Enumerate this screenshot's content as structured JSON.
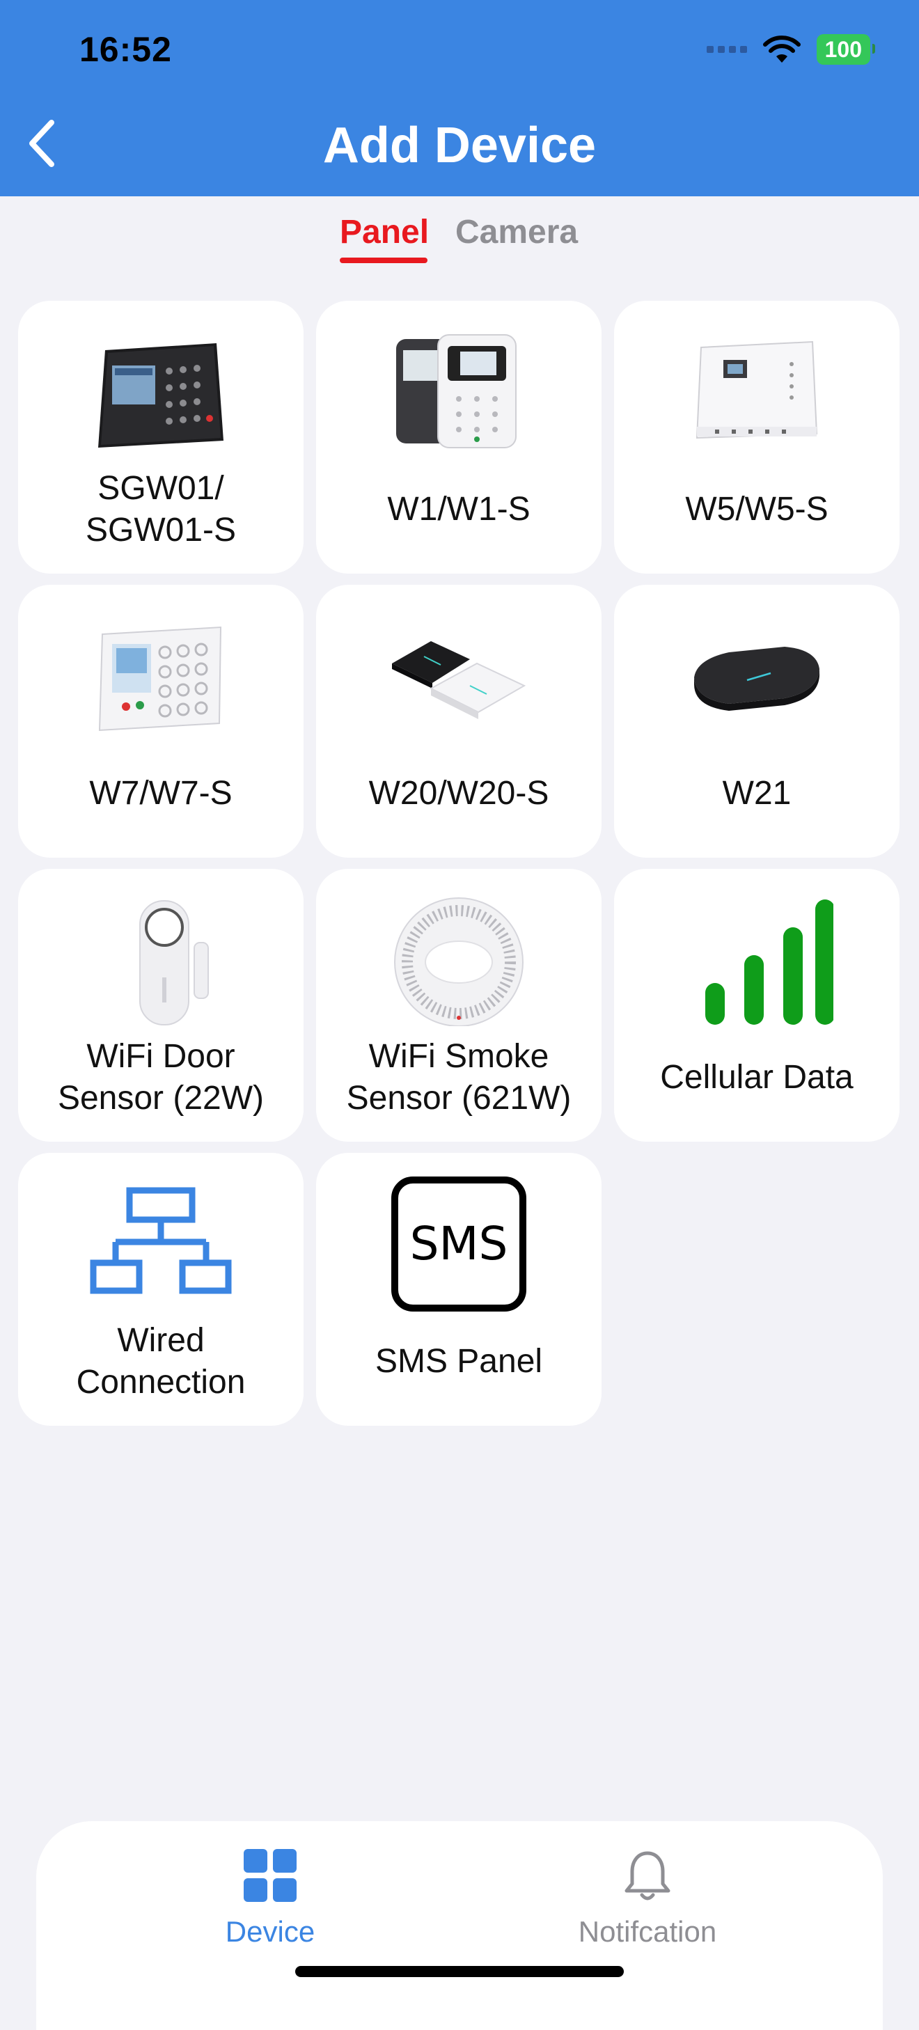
{
  "status": {
    "time": "16:52",
    "battery": "100"
  },
  "header": {
    "title": "Add Device"
  },
  "tabs": {
    "panel": "Panel",
    "camera": "Camera"
  },
  "devices": [
    {
      "line1": "SGW01/",
      "line2": "SGW01-S"
    },
    {
      "line1": "W1/W1-S",
      "line2": ""
    },
    {
      "line1": "W5/W5-S",
      "line2": ""
    },
    {
      "line1": "W7/W7-S",
      "line2": ""
    },
    {
      "line1": "W20/W20-S",
      "line2": ""
    },
    {
      "line1": "W21",
      "line2": ""
    },
    {
      "line1": "WiFi Door",
      "line2": "Sensor (22W)"
    },
    {
      "line1": "WiFi Smoke",
      "line2": "Sensor (621W)"
    },
    {
      "line1": "Cellular Data",
      "line2": ""
    },
    {
      "line1": "Wired",
      "line2": "Connection"
    },
    {
      "line1": "SMS Panel",
      "line2": ""
    }
  ],
  "sms_icon_text": "SMS",
  "tabbar": {
    "device": "Device",
    "notification": "Notifcation"
  },
  "colors": {
    "header": "#3b85e2",
    "active_tab": "#e8191f",
    "cellular_green": "#0f9d1a",
    "accent_blue": "#3b85e2"
  }
}
